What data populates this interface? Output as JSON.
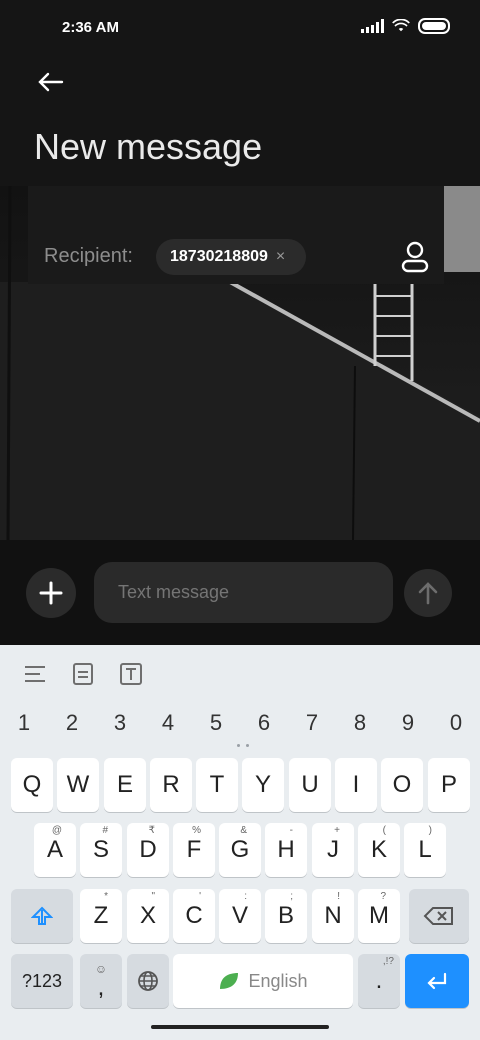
{
  "status_bar": {
    "time": "2:36 AM"
  },
  "header": {
    "title": "New message"
  },
  "recipient": {
    "label": "Recipient:",
    "chips": [
      {
        "number": "18730218809",
        "remove": "×"
      }
    ]
  },
  "compose": {
    "placeholder": "Text message"
  },
  "keyboard": {
    "numbers": [
      "1",
      "2",
      "3",
      "4",
      "5",
      "6",
      "7",
      "8",
      "9",
      "0"
    ],
    "row1": [
      "Q",
      "W",
      "E",
      "R",
      "T",
      "Y",
      "U",
      "I",
      "O",
      "P"
    ],
    "row2": [
      "A",
      "S",
      "D",
      "F",
      "G",
      "H",
      "J",
      "K",
      "L"
    ],
    "row2_hints": [
      "@",
      "#",
      "₹",
      "%",
      "&",
      "-",
      "+",
      "(",
      ")"
    ],
    "row3": [
      "Z",
      "X",
      "C",
      "V",
      "B",
      "N",
      "M"
    ],
    "row3_hints": [
      "*",
      "\"",
      "'",
      ":",
      ";",
      "!",
      "?"
    ],
    "symbols_key": "?123",
    "comma_key": ",",
    "period_key": ".",
    "period_hint": ",!?",
    "space_label": "English"
  },
  "colors": {
    "accent": "#1e90ff",
    "leaf_green": "#4caf50"
  }
}
